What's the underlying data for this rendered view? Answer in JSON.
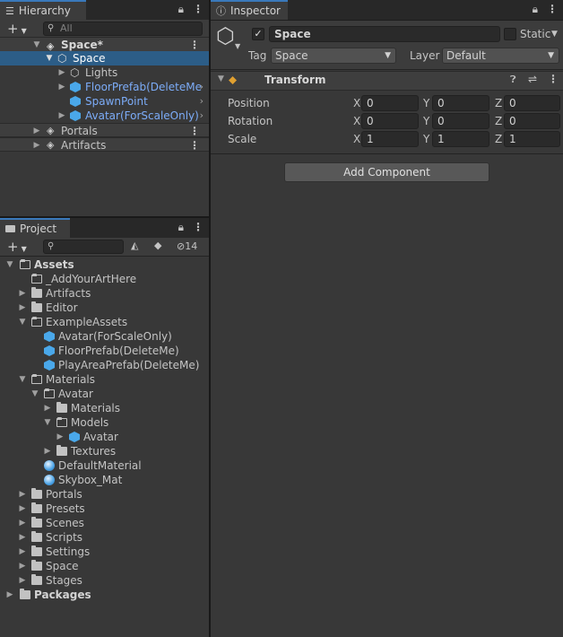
{
  "hierarchy": {
    "tab": "Hierarchy",
    "search_placeholder": "All",
    "scene_name": "Space*",
    "items": [
      {
        "label": "Space",
        "selected": true
      },
      {
        "label": "Lights"
      },
      {
        "label": "FloorPrefab(DeleteMe"
      },
      {
        "label": "SpawnPoint"
      },
      {
        "label": "Avatar(ForScaleOnly)"
      }
    ],
    "scenes": [
      "Portals",
      "Artifacts"
    ]
  },
  "inspector": {
    "tab": "Inspector",
    "object_name": "Space",
    "static_label": "Static",
    "tag_label": "Tag",
    "tag_value": "Space",
    "layer_label": "Layer",
    "layer_value": "Default",
    "component_title": "Transform",
    "rows": [
      {
        "label": "Position",
        "x": "0",
        "y": "0",
        "z": "0"
      },
      {
        "label": "Rotation",
        "x": "0",
        "y": "0",
        "z": "0"
      },
      {
        "label": "Scale",
        "x": "1",
        "y": "1",
        "z": "1"
      }
    ],
    "axis_x": "X",
    "axis_y": "Y",
    "axis_z": "Z",
    "add_component": "Add Component"
  },
  "project": {
    "tab": "Project",
    "hidden_count": "14",
    "tree": [
      {
        "label": "Assets",
        "bold": true
      },
      {
        "label": "_AddYourArtHere"
      },
      {
        "label": "Artifacts"
      },
      {
        "label": "Editor"
      },
      {
        "label": "ExampleAssets"
      },
      {
        "label": "Avatar(ForScaleOnly)"
      },
      {
        "label": "FloorPrefab(DeleteMe)"
      },
      {
        "label": "PlayAreaPrefab(DeleteMe)"
      },
      {
        "label": "Materials"
      },
      {
        "label": "Avatar"
      },
      {
        "label": "Materials"
      },
      {
        "label": "Models"
      },
      {
        "label": "Avatar"
      },
      {
        "label": "Textures"
      },
      {
        "label": "DefaultMaterial"
      },
      {
        "label": "Skybox_Mat"
      },
      {
        "label": "Portals"
      },
      {
        "label": "Presets"
      },
      {
        "label": "Scenes"
      },
      {
        "label": "Scripts"
      },
      {
        "label": "Settings"
      },
      {
        "label": "Space"
      },
      {
        "label": "Stages"
      },
      {
        "label": "Packages",
        "bold": true
      }
    ]
  }
}
